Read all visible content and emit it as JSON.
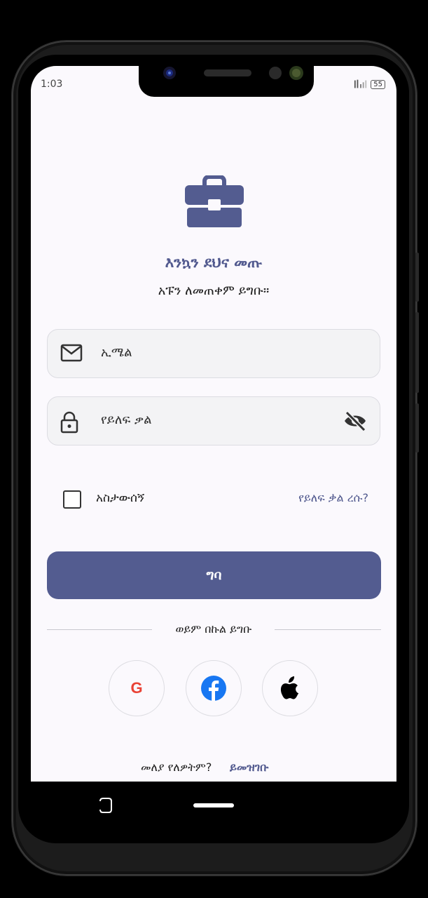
{
  "status_bar": {
    "time": "1:03",
    "battery": "55"
  },
  "login": {
    "title": "እንኳን ደህና መጡ",
    "subtitle": "አፑን ለመጠቀም ይግቡ።",
    "email_placeholder": "ኢሜል",
    "password_placeholder": "የይለፍ ቃል",
    "remember_me": "አስታውሰኝ",
    "forgot_password": "የይለፍ ቃል ረሱ?",
    "login_button": "ግባ",
    "or_login_with": "ወይም በኩል ይግቡ",
    "no_account": "መለያ የለዎትም?",
    "register": "ይመዝገቡ"
  },
  "social": {
    "google_letter": "G",
    "icons": [
      "google-icon",
      "facebook-icon",
      "apple-icon"
    ]
  },
  "colors": {
    "primary": "#535c90",
    "background": "#fbf9fd",
    "field_bg": "#f3f3f5",
    "google": "#e94235",
    "facebook": "#1877f2"
  }
}
